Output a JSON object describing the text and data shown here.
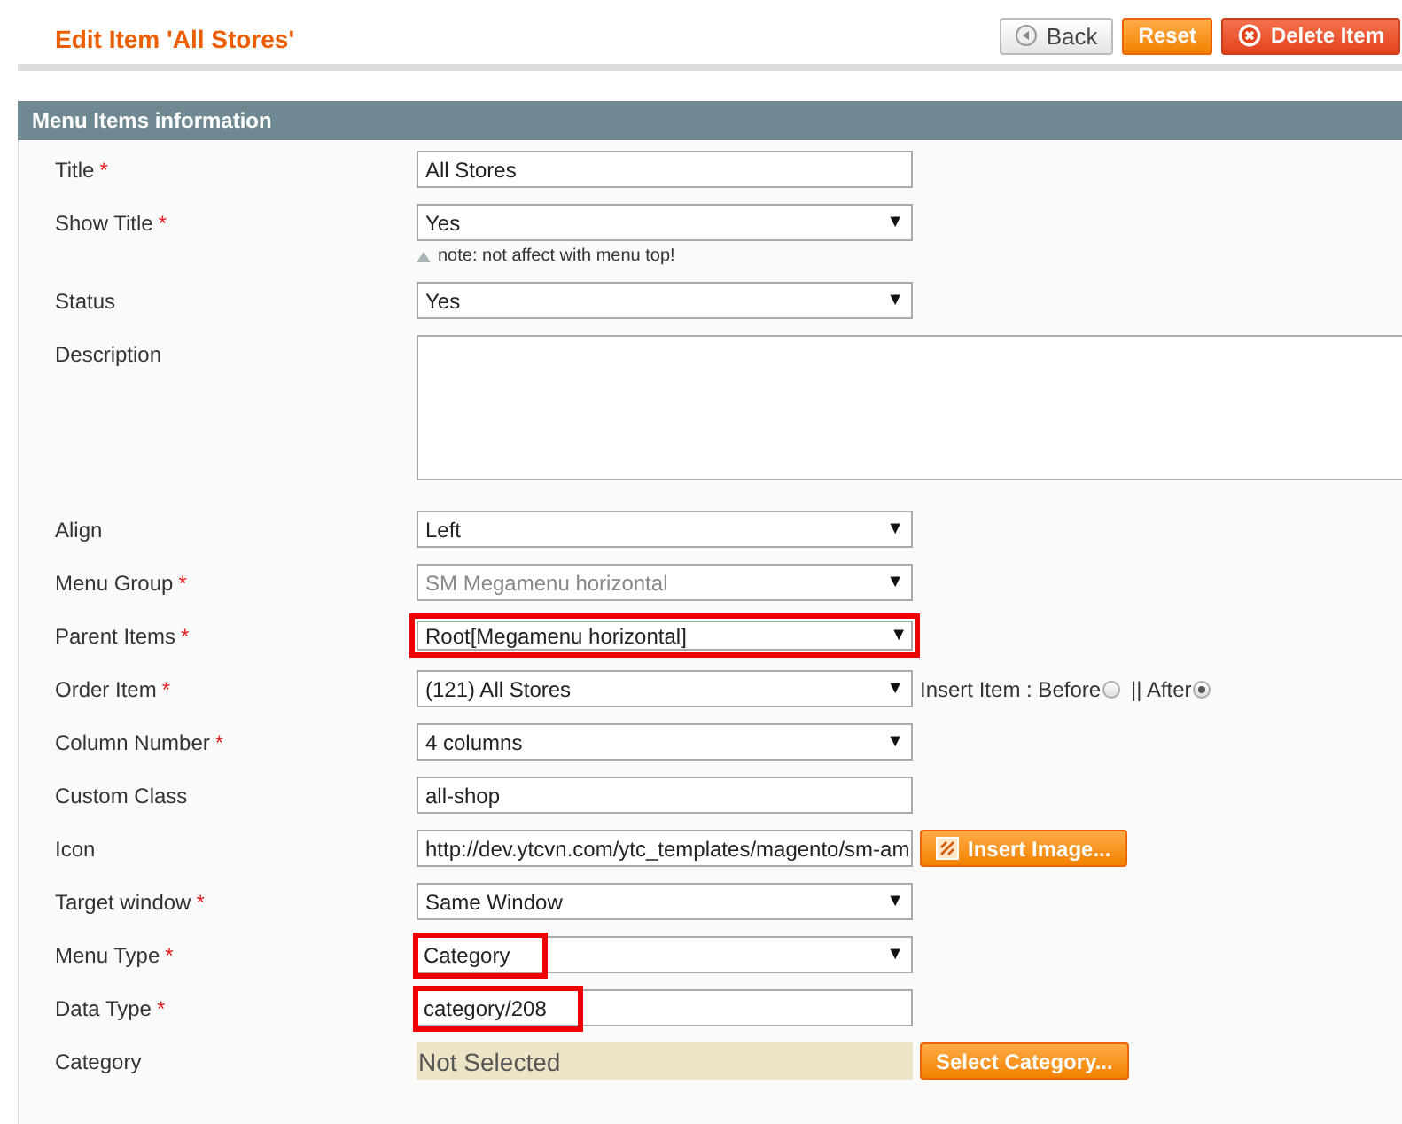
{
  "header": {
    "title": "Edit Item 'All Stores'",
    "buttons": [
      {
        "label": "Back",
        "kind": "back"
      },
      {
        "label": "Reset",
        "kind": "reset"
      },
      {
        "label": "Delete Item",
        "kind": "delete"
      }
    ]
  },
  "section": {
    "title": "Menu Items information"
  },
  "fields": [
    {
      "label": "Title",
      "required_mark": "*",
      "kind": "text",
      "value": "All Stores",
      "boxed": false,
      "value_boxed": false
    },
    {
      "label": "Show Title",
      "required_mark": "*",
      "kind": "select",
      "value": "Yes",
      "caret": "▼",
      "disabled": false,
      "boxed": false,
      "value_boxed": false,
      "note": "note: not affect with menu top!"
    },
    {
      "label": "Status",
      "kind": "select",
      "value": "Yes",
      "caret": "▼",
      "disabled": false,
      "boxed": false,
      "value_boxed": false
    },
    {
      "label": "Description",
      "kind": "textarea",
      "boxed": false
    },
    {
      "label": "Align",
      "kind": "select",
      "value": "Left",
      "caret": "▼",
      "disabled": false,
      "boxed": false,
      "value_boxed": false
    },
    {
      "label": "Menu Group",
      "required_mark": "*",
      "kind": "select",
      "value": "SM Megamenu horizontal",
      "caret": "▼",
      "disabled": true,
      "boxed": false,
      "value_boxed": false
    },
    {
      "label": "Parent Items",
      "required_mark": "*",
      "kind": "select",
      "value": "Root[Megamenu horizontal]",
      "caret": "▼",
      "disabled": false,
      "boxed": true,
      "value_boxed": false
    },
    {
      "label": "Order Item",
      "required_mark": "*",
      "kind": "select",
      "value": "(121) All Stores",
      "caret": "▼",
      "disabled": false,
      "boxed": false,
      "value_boxed": false,
      "options": [
        {
          "label": "Insert Item : Before",
          "selected": false
        },
        {
          "label": "|| After",
          "selected": true
        }
      ]
    },
    {
      "label": "Column Number",
      "required_mark": "*",
      "kind": "select",
      "value": "4 columns",
      "caret": "▼",
      "disabled": false,
      "boxed": false,
      "value_boxed": false
    },
    {
      "label": "Custom Class",
      "kind": "text",
      "value": "all-shop",
      "boxed": false,
      "value_boxed": false
    },
    {
      "label": "Icon",
      "kind": "text",
      "value": "http://dev.ytcvn.com/ytc_templates/magento/sm-am",
      "boxed": false,
      "value_boxed": false,
      "button": "Insert Image..."
    },
    {
      "label": "Target window",
      "required_mark": "*",
      "kind": "select",
      "value": "Same Window",
      "caret": "▼",
      "disabled": false,
      "boxed": false,
      "value_boxed": false
    },
    {
      "label": "Menu Type",
      "required_mark": "*",
      "kind": "select",
      "value": "Category",
      "caret": "▼",
      "disabled": false,
      "boxed": false,
      "value_boxed": true
    },
    {
      "label": "Data Type",
      "required_mark": "*",
      "kind": "text",
      "value": "category/208",
      "boxed": false,
      "value_boxed": true
    },
    {
      "label": "Category",
      "kind": "chooser",
      "value": "Not Selected",
      "boxed": false,
      "value_boxed": false,
      "button": "Select Category..."
    }
  ]
}
